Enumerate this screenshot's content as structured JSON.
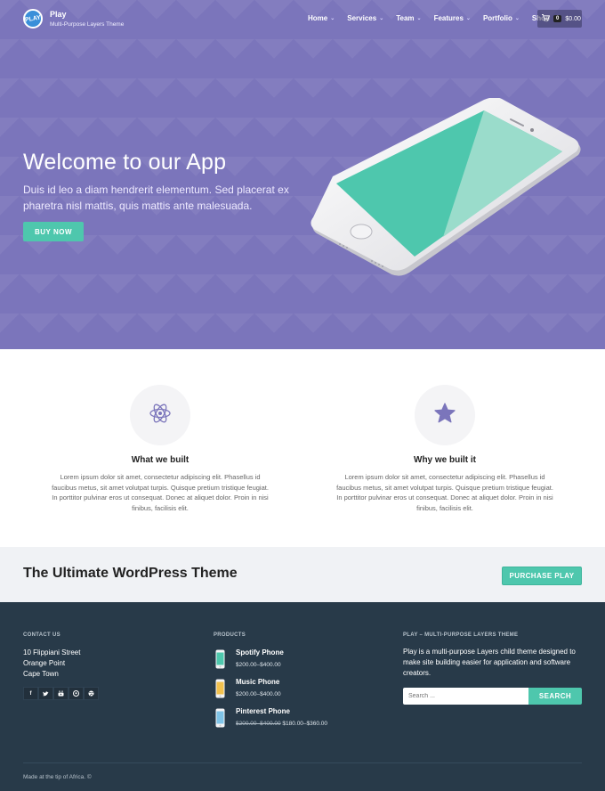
{
  "header": {
    "logo_text": "PLAY",
    "site_title": "Play",
    "tagline": "Multi-Purpose Layers Theme",
    "nav": [
      {
        "label": "Home",
        "icon": "chevron-down-icon"
      },
      {
        "label": "Services",
        "icon": "chevron-down-icon"
      },
      {
        "label": "Team",
        "icon": "chevron-down-icon"
      },
      {
        "label": "Features",
        "icon": "chevron-down-icon"
      },
      {
        "label": "Portfolio",
        "icon": "chevron-down-icon"
      },
      {
        "label": "Shop",
        "icon": "chevron-down-icon"
      }
    ],
    "cart": {
      "count": "0",
      "total": "$0.00",
      "icon": "cart-icon"
    }
  },
  "hero": {
    "title": "Welcome to our App",
    "subtitle": "Duis id leo a diam hendrerit elementum. Sed placerat ex pharetra nisl mattis, quis mattis ante malesuada.",
    "button": "BUY NOW",
    "background_color": "#7b75bb"
  },
  "features": [
    {
      "icon": "atom-icon",
      "title": "What we built",
      "text": "Lorem ipsum dolor sit amet, consectetur adipiscing elit. Phasellus id faucibus metus, sit amet volutpat turpis. Quisque pretium tristique feugiat. In porttitor pulvinar eros ut consequat. Donec at aliquet dolor. Proin in nisi finibus, facilisis elit."
    },
    {
      "icon": "star-icon",
      "title": "Why we built it",
      "text": "Lorem ipsum dolor sit amet, consectetur adipiscing elit. Phasellus id faucibus metus, sit amet volutpat turpis. Quisque pretium tristique feugiat. In porttitor pulvinar eros ut consequat. Donec at aliquet dolor. Proin in nisi finibus, facilisis elit."
    }
  ],
  "cta": {
    "title": "The Ultimate WordPress Theme",
    "button": "PURCHASE PLAY"
  },
  "footer": {
    "contact": {
      "heading": "CONTACT US",
      "lines": [
        "10 Flippiani Street",
        "Orange Point",
        "Cape Town"
      ],
      "socials": [
        "facebook-icon",
        "twitter-icon",
        "youtube-icon",
        "pinterest-icon",
        "dribbble-icon"
      ]
    },
    "products": {
      "heading": "PRODUCTS",
      "items": [
        {
          "name": "Spotify Phone",
          "price": "$200.00–$400.00",
          "old_price": "",
          "thumb_color": "#4ec7ad"
        },
        {
          "name": "Music Phone",
          "price": "$200.00–$400.00",
          "old_price": "",
          "thumb_color": "#f2c14e"
        },
        {
          "name": "Pinterest Phone",
          "price": "$180.00–$360.00",
          "old_price": "$200.00–$400.00",
          "thumb_color": "#7fc4e8"
        }
      ]
    },
    "about": {
      "heading": "PLAY – MULTI-PURPOSE LAYERS THEME",
      "text": "Play is a multi-purpose Layers child theme designed to make site building easier for application and software creators.",
      "search_placeholder": "Search ...",
      "search_button": "SEARCH"
    },
    "copyright": "Made at the tip of Africa. ©",
    "accent_color": "#4ec7ad",
    "background_color": "#283a49"
  }
}
